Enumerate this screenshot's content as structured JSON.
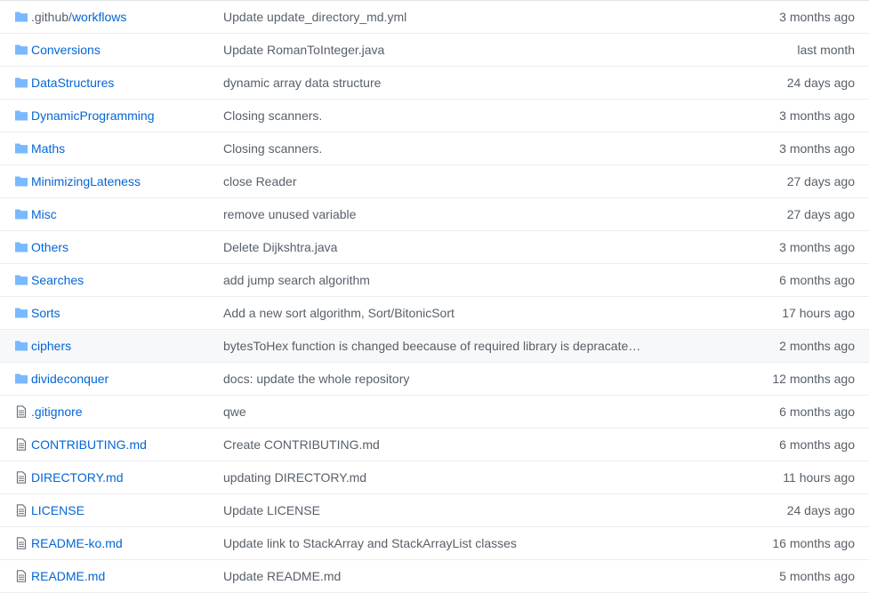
{
  "colors": {
    "link": "#0366d6",
    "muted": "#586069",
    "folder_icon": "#79b8ff",
    "file_icon": "#6a737d",
    "row_border": "#eaecef",
    "hover_row": "#f6f8fa"
  },
  "rows": [
    {
      "name_dim": ".github/",
      "name": "workflows",
      "icon": "folder-icon",
      "message": "Update update_directory_md.yml",
      "age": "3 months ago"
    },
    {
      "name_dim": "",
      "name": "Conversions",
      "icon": "folder-icon",
      "message": "Update RomanToInteger.java",
      "age": "last month"
    },
    {
      "name_dim": "",
      "name": "DataStructures",
      "icon": "folder-icon",
      "message": "dynamic array data structure",
      "age": "24 days ago"
    },
    {
      "name_dim": "",
      "name": "DynamicProgramming",
      "icon": "folder-icon",
      "message": "Closing scanners.",
      "age": "3 months ago"
    },
    {
      "name_dim": "",
      "name": "Maths",
      "icon": "folder-icon",
      "message": "Closing scanners.",
      "age": "3 months ago"
    },
    {
      "name_dim": "",
      "name": "MinimizingLateness",
      "icon": "folder-icon",
      "message": "close Reader",
      "age": "27 days ago"
    },
    {
      "name_dim": "",
      "name": "Misc",
      "icon": "folder-icon",
      "message": "remove unused variable",
      "age": "27 days ago"
    },
    {
      "name_dim": "",
      "name": "Others",
      "icon": "folder-icon",
      "message": "Delete Dijkshtra.java",
      "age": "3 months ago"
    },
    {
      "name_dim": "",
      "name": "Searches",
      "icon": "folder-icon",
      "message": "add jump search algorithm",
      "age": "6 months ago"
    },
    {
      "name_dim": "",
      "name": "Sorts",
      "icon": "folder-icon",
      "message": "Add a new sort algorithm, Sort/BitonicSort",
      "age": "17 hours ago"
    },
    {
      "name_dim": "",
      "name": "ciphers",
      "icon": "folder-icon",
      "message": "bytesToHex function is changed beecause of required library is depracated...",
      "age": "2 months ago",
      "hover": true
    },
    {
      "name_dim": "",
      "name": "divideconquer",
      "icon": "folder-icon",
      "message": "docs: update the whole repository",
      "age": "12 months ago"
    },
    {
      "name_dim": "",
      "name": ".gitignore",
      "icon": "file-icon",
      "message": "qwe",
      "age": "6 months ago"
    },
    {
      "name_dim": "",
      "name": "CONTRIBUTING.md",
      "icon": "file-icon",
      "message": "Create CONTRIBUTING.md",
      "age": "6 months ago"
    },
    {
      "name_dim": "",
      "name": "DIRECTORY.md",
      "icon": "file-icon",
      "message": "updating DIRECTORY.md",
      "age": "11 hours ago"
    },
    {
      "name_dim": "",
      "name": "LICENSE",
      "icon": "file-icon",
      "message": "Update LICENSE",
      "age": "24 days ago"
    },
    {
      "name_dim": "",
      "name": "README-ko.md",
      "icon": "file-icon",
      "message": "Update link to StackArray and StackArrayList classes",
      "age": "16 months ago"
    },
    {
      "name_dim": "",
      "name": "README.md",
      "icon": "file-icon",
      "message": "Update README.md",
      "age": "5 months ago"
    }
  ]
}
